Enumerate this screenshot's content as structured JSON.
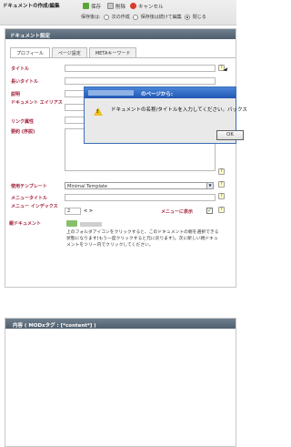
{
  "header": {
    "title": "ドキュメントの作成/編集",
    "save_label": "保存",
    "delete_label": "削除",
    "cancel_label": "キャンセル",
    "after_save_label": "保存後は:",
    "options": [
      "次の作成",
      "保存後は続けて編集",
      "閉じる"
    ],
    "selected_option": 2
  },
  "document_panel": {
    "title": "ドキュメント設定",
    "tabs": [
      "プロフィール",
      "ページ設定",
      "METAキーワード"
    ],
    "active_tab": 0,
    "fields": [
      {
        "label": "タイトル"
      },
      {
        "label": "長いタイトル"
      },
      {
        "label": "説明"
      },
      {
        "label": "ドキュメント エイリアス"
      },
      {
        "label": "リンク属性"
      },
      {
        "label": "要約 (序説)"
      }
    ],
    "template_label": "使用テンプレート",
    "template_value": "Minimal Template",
    "menu_title_label": "メニュータイトル",
    "menu_index_label": "メニュー インデックス",
    "menu_index_value": "2",
    "menu_index_arrows": "< >",
    "show_in_menu_label": "メニューに表示",
    "parent_label": "親ドキュメント",
    "parent_help": "上のフォルダアイコンをクリックすると、このドキュメントの親を選択できる状態になります(もう一度クリックすると元に戻ります)。次に新しい親ドキュメントをツリー内でクリックしてください。"
  },
  "dialog": {
    "title": "のページから:",
    "message": "ドキュメントの名称/タイトルを入力してください。バックス",
    "ok_label": "OK"
  },
  "content_panel": {
    "title": "内容 ( MODxタグ : [*content*] )"
  },
  "colors": {
    "label_red": "#a3223c",
    "panel_header": "#5f6f7e",
    "dialog_title": "#2e68c4"
  }
}
